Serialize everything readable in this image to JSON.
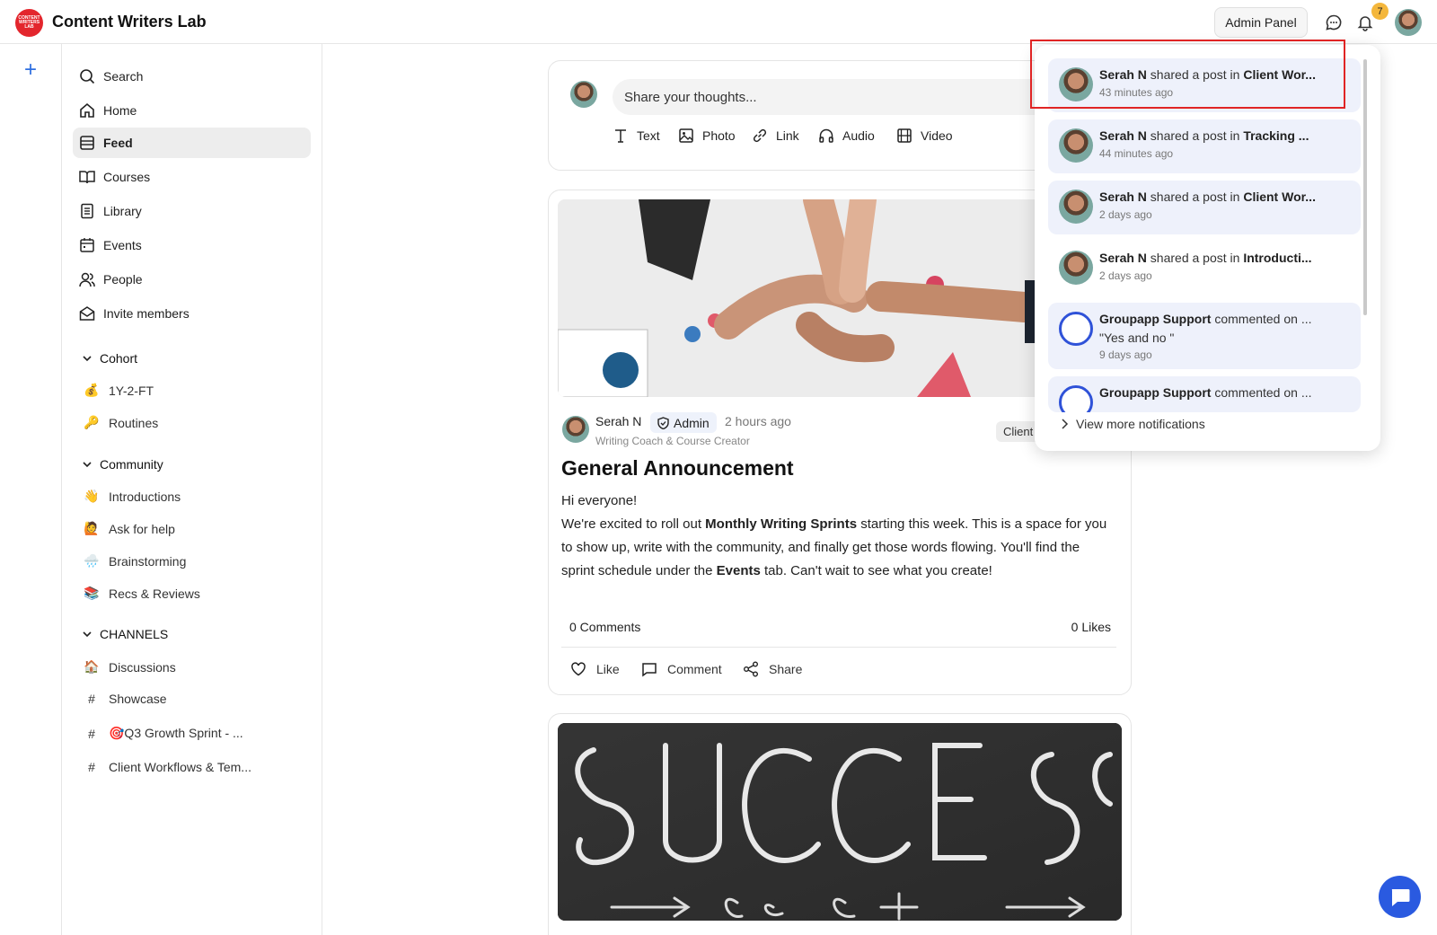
{
  "app": {
    "title": "Content Writers Lab",
    "logo_text": "CONTENT WRITERS LAB"
  },
  "topbar": {
    "admin_panel_label": "Admin Panel",
    "notification_count": "7"
  },
  "sidebar": {
    "nav": [
      {
        "label": "Search",
        "icon": "search-icon"
      },
      {
        "label": "Home",
        "icon": "home-icon"
      },
      {
        "label": "Feed",
        "icon": "feed-icon",
        "active": true
      },
      {
        "label": "Courses",
        "icon": "book-icon"
      },
      {
        "label": "Library",
        "icon": "library-icon"
      },
      {
        "label": "Events",
        "icon": "calendar-icon"
      },
      {
        "label": "People",
        "icon": "people-icon"
      },
      {
        "label": "Invite members",
        "icon": "envelope-icon"
      }
    ],
    "cohort": {
      "title": "Cohort",
      "items": [
        {
          "emoji": "💰",
          "label": "1Y-2-FT"
        },
        {
          "emoji": "🔑",
          "label": "Routines"
        }
      ]
    },
    "community": {
      "title": "Community",
      "items": [
        {
          "emoji": "👋",
          "label": "Introductions"
        },
        {
          "emoji": "🙋",
          "label": "Ask for help"
        },
        {
          "emoji": "🌧️",
          "label": "Brainstorming"
        },
        {
          "emoji": "📚",
          "label": "Recs & Reviews"
        }
      ]
    },
    "channels": {
      "title": "CHANNELS",
      "items": [
        {
          "emoji": "🏠",
          "label": "Discussions"
        },
        {
          "emoji": "#",
          "label": "Showcase"
        },
        {
          "emoji": "#",
          "label": "🎯Q3 Growth Sprint - ..."
        },
        {
          "emoji": "#",
          "label": "Client Workflows & Tem..."
        }
      ]
    }
  },
  "composer": {
    "placeholder": "Share your thoughts...",
    "types": [
      "Text",
      "Photo",
      "Link",
      "Audio",
      "Video"
    ]
  },
  "post": {
    "author": "Serah N",
    "badge": "Admin",
    "time": "2 hours ago",
    "role": "Writing Coach & Course Creator",
    "channel": "Client",
    "title": "General Announcement",
    "line1": "Hi everyone!",
    "p_a": "We're excited to roll out ",
    "p_b": "Monthly Writing Sprints",
    "p_c": " starting this week. This is a space for you to show up, write with the community, and finally get those words flowing. You'll find the sprint schedule under the ",
    "p_d": "Events",
    "p_e": " tab. Can't wait to see what you create!",
    "comments": "0 Comments",
    "likes": "0 Likes",
    "actions": [
      "Like",
      "Comment",
      "Share"
    ]
  },
  "notifications": {
    "items": [
      {
        "name": "Serah N",
        "verb": " shared a post in ",
        "target": "Client Wor...",
        "ago": "43 minutes ago",
        "highlighted": true
      },
      {
        "name": "Serah N",
        "verb": " shared a post in ",
        "target": "Tracking ...",
        "ago": "44 minutes ago"
      },
      {
        "name": "Serah N",
        "verb": " shared a post in ",
        "target": "Client Wor...",
        "ago": "2 days ago"
      },
      {
        "name": "Serah N",
        "verb": " shared a post in ",
        "target": "Introducti...",
        "ago": "2 days ago",
        "read": true
      },
      {
        "name": "Groupapp Support",
        "verb": " commented on ...",
        "quote": "\"Yes and no \"",
        "ago": "9 days ago"
      },
      {
        "name": "Groupapp Support",
        "verb": " commented on ..."
      }
    ],
    "view_more": "View more notifications"
  },
  "colors": {
    "accent": "#2f6fe0",
    "highlight_box": "#e02424",
    "badge": "#f4b73c",
    "logo": "#e3262d",
    "chat_fab": "#2a5ae0"
  }
}
